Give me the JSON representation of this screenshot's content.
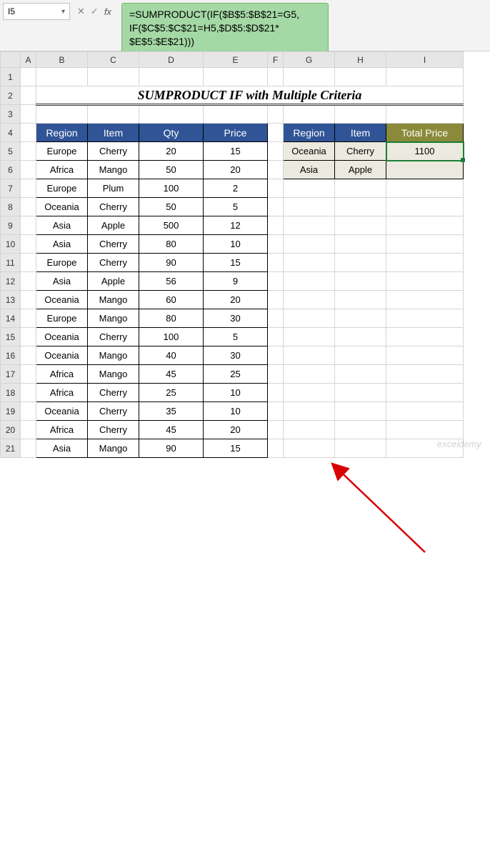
{
  "namebox": "I5",
  "fx_label": "fx",
  "formula_lines": [
    "=SUMPRODUCT(IF($B$5:$B$21=G5,",
    "IF($C$5:$C$21=H5,$D$5:$D$21*",
    "$E$5:$E$21)))"
  ],
  "columns": [
    "",
    "A",
    "B",
    "C",
    "D",
    "E",
    "F",
    "G",
    "H",
    "I"
  ],
  "title": "SUMPRODUCT IF with Multiple Criteria",
  "main_headers": {
    "region": "Region",
    "item": "Item",
    "qty": "Qty",
    "price": "Price"
  },
  "main_rows": [
    {
      "region": "Europe",
      "item": "Cherry",
      "qty": "20",
      "price": "15"
    },
    {
      "region": "Africa",
      "item": "Mango",
      "qty": "50",
      "price": "20"
    },
    {
      "region": "Europe",
      "item": "Plum",
      "qty": "100",
      "price": "2"
    },
    {
      "region": "Oceania",
      "item": "Cherry",
      "qty": "50",
      "price": "5"
    },
    {
      "region": "Asia",
      "item": "Apple",
      "qty": "500",
      "price": "12"
    },
    {
      "region": "Asia",
      "item": "Cherry",
      "qty": "80",
      "price": "10"
    },
    {
      "region": "Europe",
      "item": "Cherry",
      "qty": "90",
      "price": "15"
    },
    {
      "region": "Asia",
      "item": "Apple",
      "qty": "56",
      "price": "9"
    },
    {
      "region": "Oceania",
      "item": "Mango",
      "qty": "60",
      "price": "20"
    },
    {
      "region": "Europe",
      "item": "Mango",
      "qty": "80",
      "price": "30"
    },
    {
      "region": "Oceania",
      "item": "Cherry",
      "qty": "100",
      "price": "5"
    },
    {
      "region": "Oceania",
      "item": "Mango",
      "qty": "40",
      "price": "30"
    },
    {
      "region": "Africa",
      "item": "Mango",
      "qty": "45",
      "price": "25"
    },
    {
      "region": "Africa",
      "item": "Cherry",
      "qty": "25",
      "price": "10"
    },
    {
      "region": "Oceania",
      "item": "Cherry",
      "qty": "35",
      "price": "10"
    },
    {
      "region": "Africa",
      "item": "Cherry",
      "qty": "45",
      "price": "20"
    },
    {
      "region": "Asia",
      "item": "Mango",
      "qty": "90",
      "price": "15"
    }
  ],
  "lookup_headers": {
    "region": "Region",
    "item": "Item",
    "total": "Total Price"
  },
  "lookup_rows": [
    {
      "region": "Oceania",
      "item": "Cherry",
      "total": "1100"
    },
    {
      "region": "Asia",
      "item": "Apple",
      "total": ""
    }
  ],
  "watermark": "exceldemy"
}
